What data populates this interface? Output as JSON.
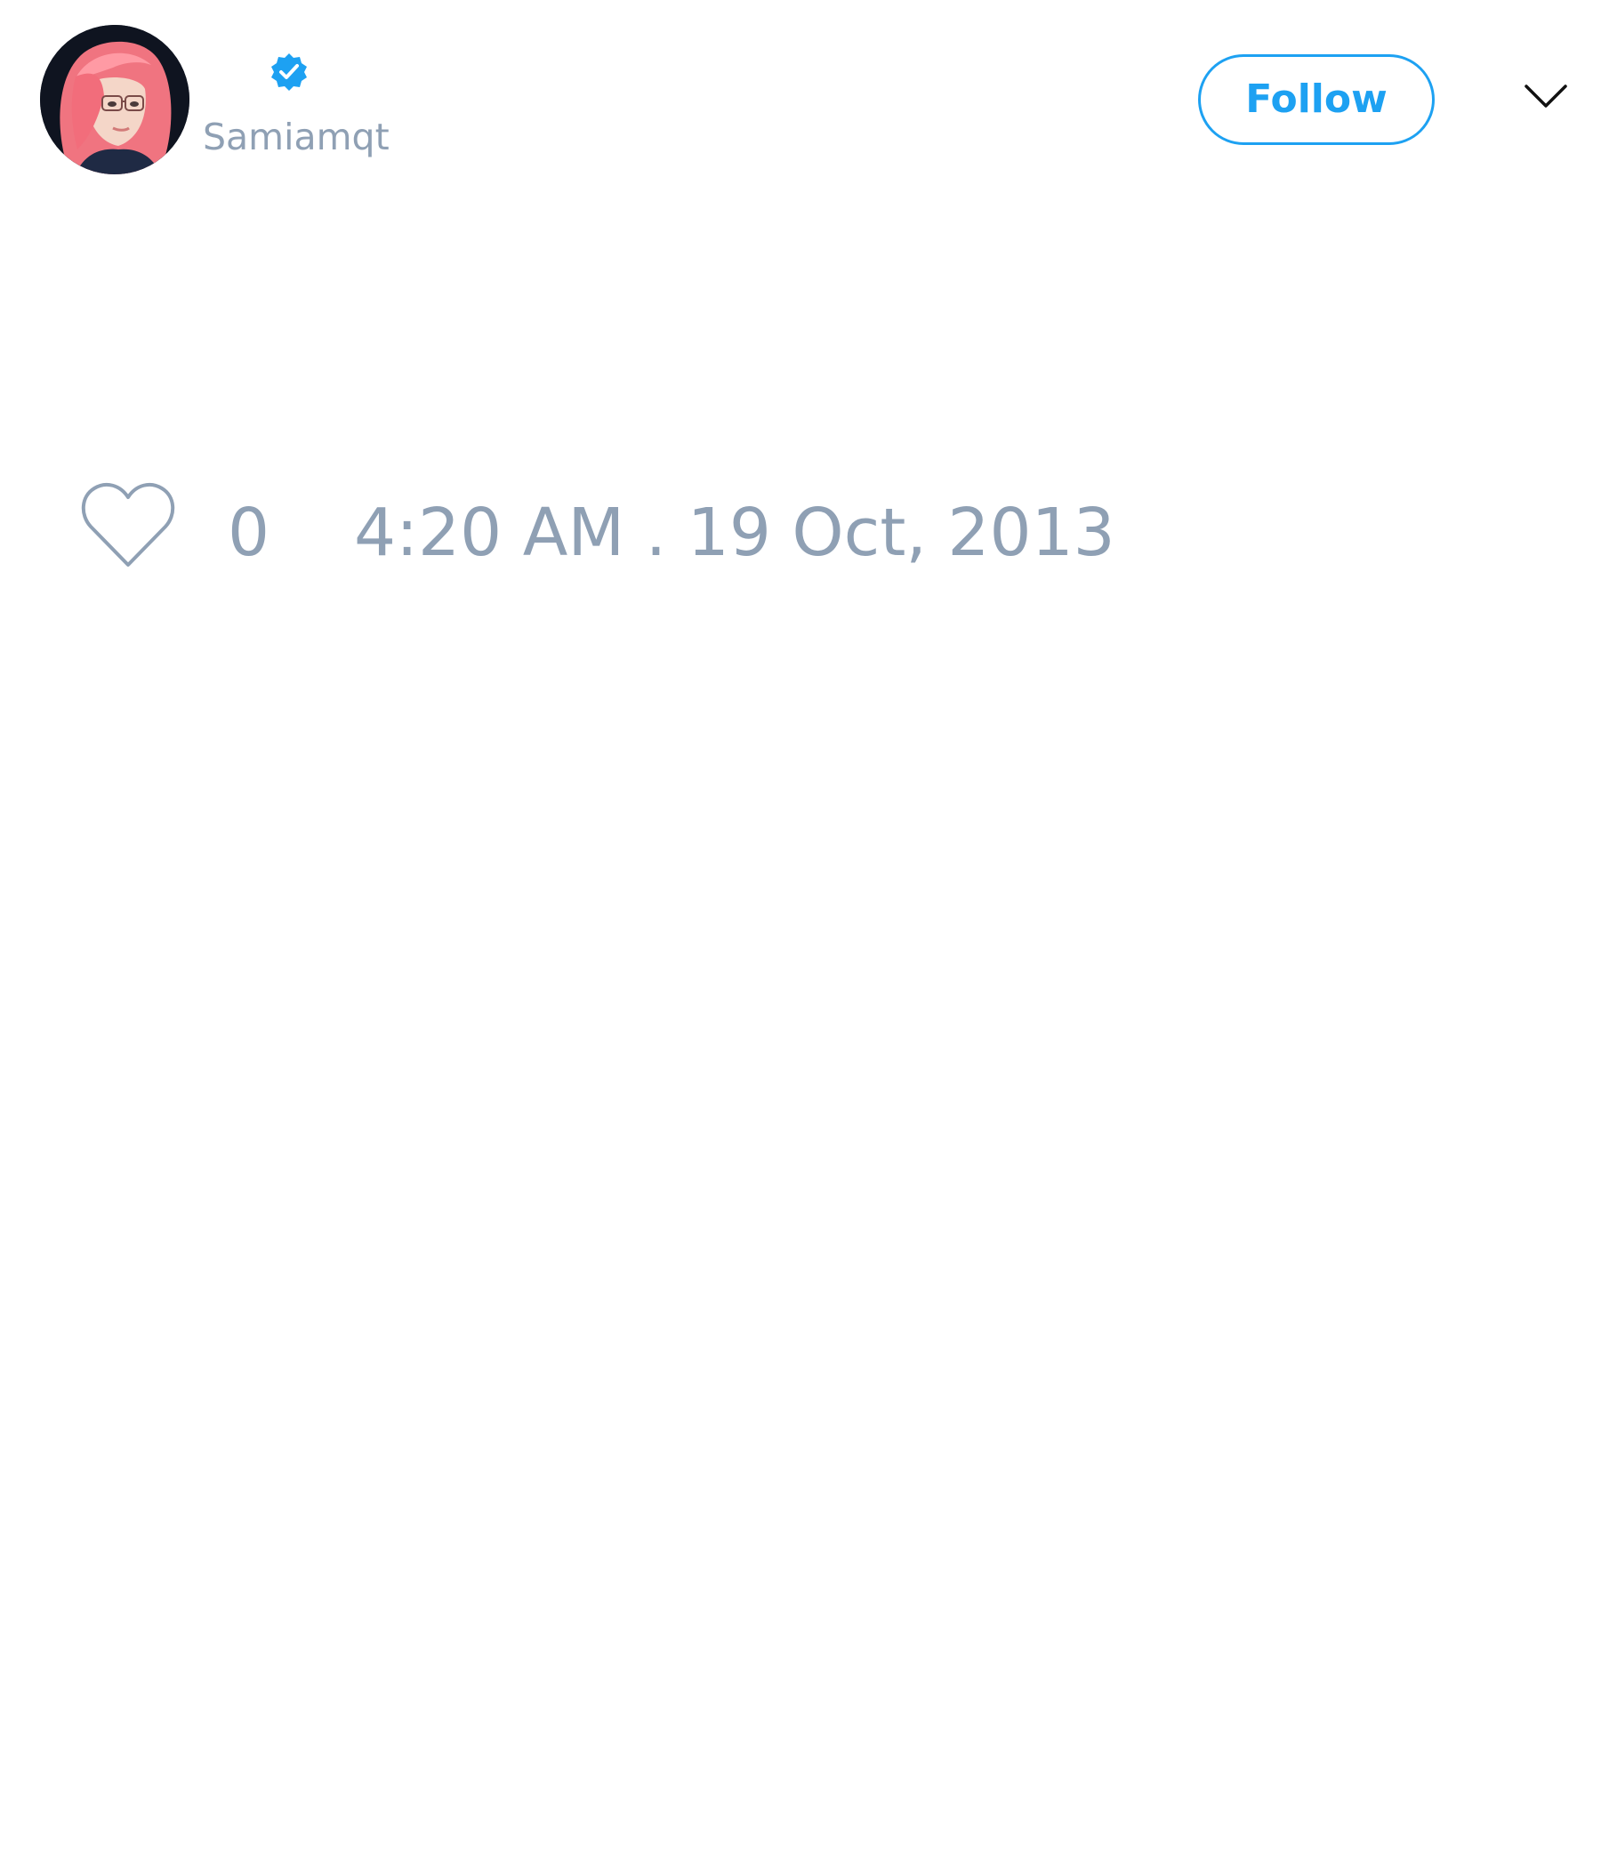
{
  "author": {
    "handle": "Samiamqt",
    "verified": true,
    "avatar_icon": "avatar-portrait"
  },
  "header": {
    "follow_label": "Follow",
    "more_icon": "chevron-down-icon"
  },
  "actions": {
    "like_icon": "heart-icon",
    "like_count": "0",
    "timestamp": "4:20 AM . 19 Oct, 2013"
  },
  "colors": {
    "accent": "#1da1f2",
    "muted_text": "#8fa0b4",
    "background": "#ffffff"
  }
}
